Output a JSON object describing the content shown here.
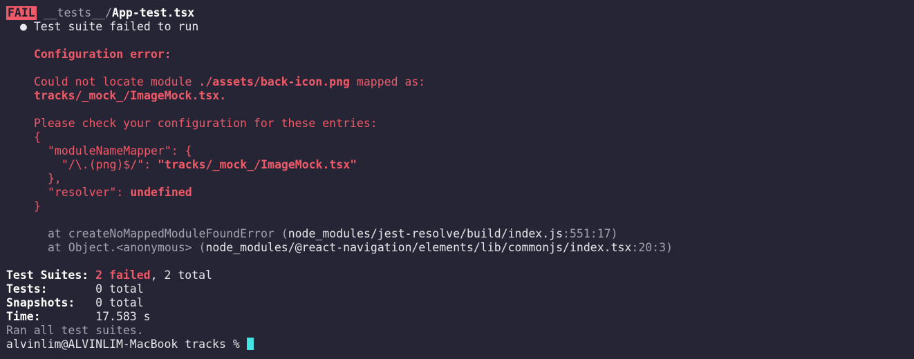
{
  "header": {
    "badge": "FAIL",
    "path_dir": "__tests__/",
    "path_file": "App-test.tsx"
  },
  "suite": {
    "bullet": "●",
    "title": "Test suite failed to run"
  },
  "error": {
    "heading": "Configuration error:",
    "locate_prefix": "Could not locate module ",
    "module": "./assets/back-icon.png",
    "mapped_as": " mapped as:",
    "mapped_path": "tracks/_mock_/ImageMock.tsx.",
    "check_msg": "Please check your configuration for these entries:",
    "open_brace": "{",
    "mapper_key": "\"moduleNameMapper\": {",
    "pattern": "\"/\\.(png)$/\": ",
    "pattern_value": "\"tracks/_mock_/ImageMock.tsx\"",
    "close_inner": "},",
    "resolver_key": "\"resolver\": ",
    "resolver_value": "undefined",
    "close_brace": "}"
  },
  "stack": [
    {
      "at": "at createNoMappedModuleFoundError (",
      "path": "node_modules/jest-resolve/build/index.js",
      "loc": ":551:17",
      "end": ")"
    },
    {
      "at": "at Object.<anonymous> (",
      "path": "node_modules/@react-navigation/elements/lib/commonjs/index.tsx",
      "loc": ":20:3",
      "end": ")"
    }
  ],
  "summary": {
    "suites_label": "Test Suites: ",
    "suites_failed": "2 failed",
    "suites_total": ", 2 total",
    "tests_label": "Tests:       ",
    "tests_value": "0 total",
    "snapshots_label": "Snapshots:   ",
    "snapshots_value": "0 total",
    "time_label": "Time:        ",
    "time_value": "17.583 s",
    "ran": "Ran all test suites."
  },
  "prompt": {
    "text": "alvinlim@ALVINLIM-MacBook tracks % "
  },
  "colors": {
    "background": "#262535",
    "error_red": "#f05a68",
    "cursor": "#44e3e3",
    "dim": "#a3a3b0"
  }
}
